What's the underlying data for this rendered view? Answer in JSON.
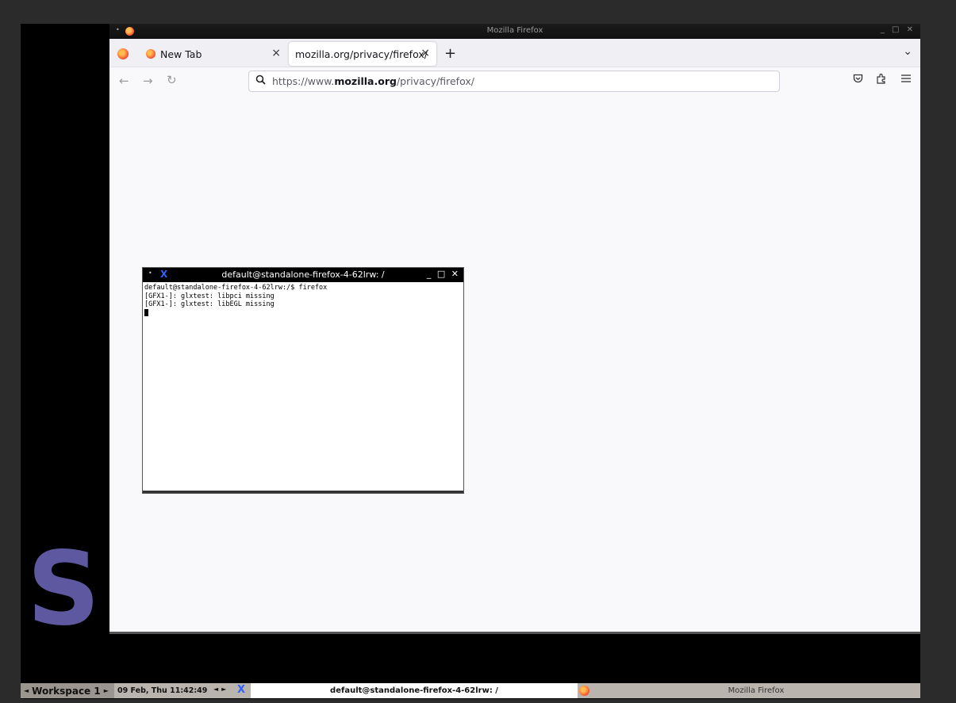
{
  "desktop": {
    "logo_letter": "S"
  },
  "firefox": {
    "window_title": "Mozilla Firefox",
    "window_controls": "_ □ ✕",
    "tabs": [
      {
        "label": "New Tab",
        "active": false
      },
      {
        "label": "mozilla.org/privacy/firefox/",
        "active": true
      }
    ],
    "tab_close_glyph": "×",
    "new_tab_glyph": "+",
    "tab_list_glyph": "⌄",
    "nav": {
      "back": "←",
      "forward": "→",
      "reload": "↻"
    },
    "url": {
      "prefix": "https://www.",
      "domain": "mozilla.org",
      "path": "/privacy/firefox/"
    }
  },
  "terminal": {
    "title": "default@standalone-firefox-4-62lrw: /",
    "window_controls": "_ □ ✕",
    "lines": [
      "default@standalone-firefox-4-62lrw:/$ firefox",
      "[GFX1-]: glxtest: libpci missing",
      "[GFX1-]: glxtest: libEGL missing"
    ]
  },
  "taskbar": {
    "workspace": "Workspace 1",
    "clock": "09 Feb, Thu 11:42:49",
    "tasks": [
      {
        "label": "default@standalone-firefox-4-62lrw: /",
        "active": true
      },
      {
        "label": "Mozilla Firefox",
        "active": false
      }
    ]
  },
  "colors": {
    "logo": "#5d58a0",
    "taskbar": "#b9b4ad",
    "page_bg": "#f9f9fb"
  }
}
